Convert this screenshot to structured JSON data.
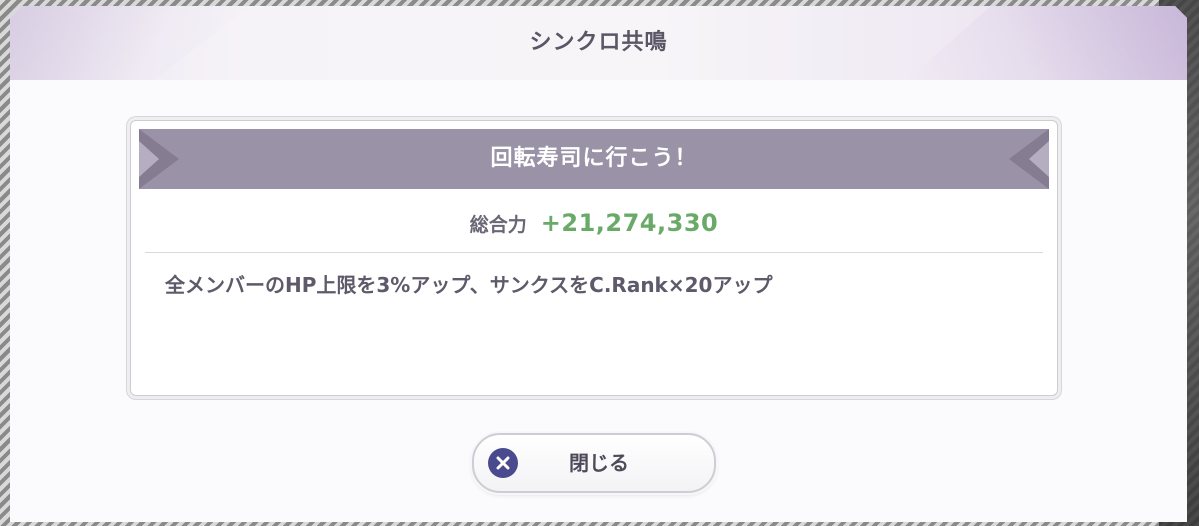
{
  "dialog": {
    "title": "シンクロ共鳴"
  },
  "card": {
    "title": "回転寿司に行こう！",
    "power_label": "総合力",
    "power_value": "+21,274,330",
    "description": "全メンバーのHP上限を3%アップ、サンクスをC.Rank×20アップ"
  },
  "close_button": {
    "label": "閉じる",
    "icon": "close-icon"
  },
  "colors": {
    "header_bar": "#9a92a6",
    "power_value": "#6aaa68",
    "close_icon_bg": "#4a4b8e"
  }
}
